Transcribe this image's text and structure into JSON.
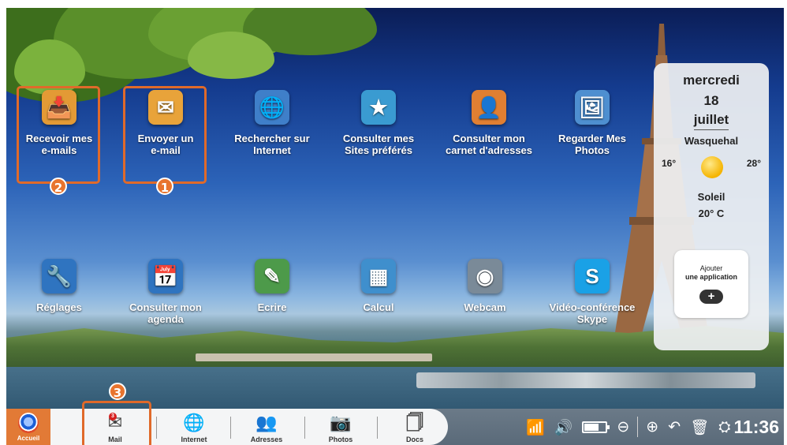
{
  "desktop": {
    "apps_row1": [
      {
        "label_1": "Recevoir mes",
        "label_2": "e-mails",
        "icon": "inbox-mail-icon",
        "color": "#e39a35"
      },
      {
        "label_1": "Envoyer un",
        "label_2": "e-mail",
        "icon": "send-mail-icon",
        "color": "#e8a33a"
      },
      {
        "label_1": "Rechercher sur",
        "label_2": "Internet",
        "icon": "web-search-icon",
        "color": "#3f7fc9"
      },
      {
        "label_1": "Consulter mes",
        "label_2": "Sites préférés",
        "icon": "favorite-sites-icon",
        "color": "#3a9bd1"
      },
      {
        "label_1": "Consulter mon",
        "label_2": "carnet d'adresses",
        "icon": "address-book-icon",
        "color": "#e07f32"
      },
      {
        "label_1": "Regarder Mes",
        "label_2": "Photos",
        "icon": "photos-icon",
        "color": "#4e8fd0"
      }
    ],
    "apps_row2": [
      {
        "label_1": "Réglages",
        "label_2": "",
        "icon": "settings-tools-icon",
        "color": "#2f74c0"
      },
      {
        "label_1": "Consulter mon",
        "label_2": "agenda",
        "icon": "calendar-icon",
        "color": "#2f74c0"
      },
      {
        "label_1": "Ecrire",
        "label_2": "",
        "icon": "write-document-icon",
        "color": "#4d9a4a"
      },
      {
        "label_1": "Calcul",
        "label_2": "",
        "icon": "spreadsheet-icon",
        "color": "#3f8fcd"
      },
      {
        "label_1": "Webcam",
        "label_2": "",
        "icon": "webcam-icon",
        "color": "#7a8a98"
      },
      {
        "label_1": "Vidéo-conférence",
        "label_2": "Skype",
        "icon": "skype-icon",
        "color": "#1aa1e6"
      }
    ],
    "callouts": [
      "1",
      "2",
      "3"
    ]
  },
  "weather": {
    "day": "mercredi",
    "date": "18",
    "month": "juillet",
    "city": "Wasquehal",
    "min": "16°",
    "max": "28°",
    "condition": "Soleil",
    "temperature": "20° C",
    "add_line1": "Ajouter",
    "add_line2": "une application",
    "add_symbol": "+"
  },
  "taskbar": {
    "home_label": "Accueil",
    "tabs": [
      {
        "label": "Mail",
        "icon": "mail-icon",
        "glyph": "✉"
      },
      {
        "label": "Internet",
        "icon": "globe-icon",
        "glyph": "🌐"
      },
      {
        "label": "Adresses",
        "icon": "contacts-icon",
        "glyph": "👥"
      },
      {
        "label": "Photos",
        "icon": "camera-icon",
        "glyph": "📷"
      },
      {
        "label": "Docs",
        "icon": "documents-icon",
        "glyph": "🗍"
      }
    ],
    "mail_badge": "3",
    "clock": "11:36"
  },
  "colors": {
    "accent": "#e27a36",
    "highlight": "#e06a2a"
  }
}
